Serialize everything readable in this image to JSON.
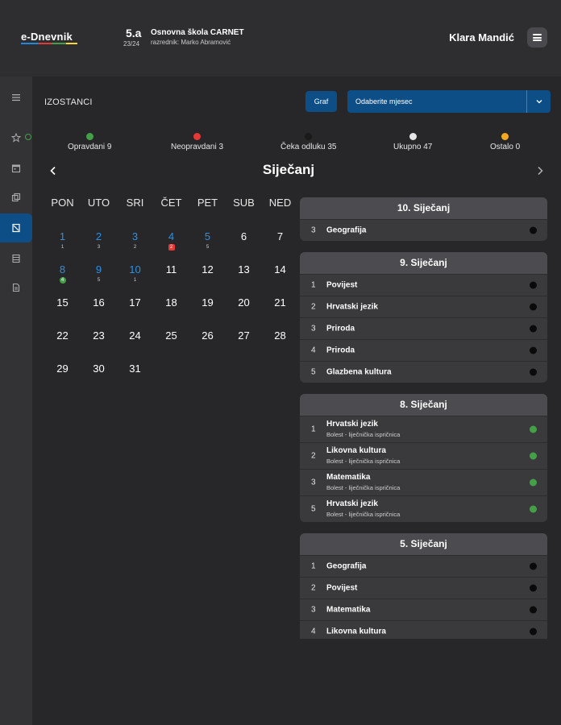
{
  "header": {
    "logo": "e-Dnevnik",
    "class_name": "5.a",
    "class_year": "23/24",
    "school_name": "Osnovna škola CARNET",
    "teacher": "razrednik: Marko Abramović",
    "user_name": "Klara Mandić"
  },
  "sidebar": {
    "items": [
      {
        "icon": "menu-icon"
      },
      {
        "icon": "star-icon"
      },
      {
        "icon": "calendar-icon"
      },
      {
        "icon": "copy-icon"
      },
      {
        "icon": "absence-icon",
        "active": true
      },
      {
        "icon": "list-icon"
      },
      {
        "icon": "document-icon"
      }
    ]
  },
  "toolbar": {
    "title": "IZOSTANCI",
    "graf_label": "Graf",
    "month_placeholder": "Odaberite mjesec"
  },
  "stats": {
    "opravdani": "Opravdani 9",
    "neopravdani": "Neopravdani 3",
    "ceka": "Čeka odluku 35",
    "ukupno": "Ukupno 47",
    "ostalo": "Ostalo 0"
  },
  "colors": {
    "opravdani": "#43a047",
    "neopravdani": "#e53935",
    "ceka": "#1a1a1a",
    "ukupno": "#e6e6e6",
    "ostalo": "#f5a623",
    "accent": "#0e4e86"
  },
  "calendar": {
    "month": "Siječanj",
    "weekdays": [
      "PON",
      "UTO",
      "SRI",
      "ČET",
      "PET",
      "SUB",
      "NED"
    ],
    "days": [
      {
        "d": "1",
        "blue": true,
        "badge": "1"
      },
      {
        "d": "2",
        "blue": true,
        "badge": "3"
      },
      {
        "d": "3",
        "blue": true,
        "badge": "2"
      },
      {
        "d": "4",
        "blue": true,
        "badge": "2",
        "badge_type": "red"
      },
      {
        "d": "5",
        "blue": true,
        "badge": "5"
      },
      {
        "d": "6"
      },
      {
        "d": "7"
      },
      {
        "d": "8",
        "blue": true,
        "badge": "4",
        "badge_type": "green"
      },
      {
        "d": "9",
        "blue": true,
        "badge": "5"
      },
      {
        "d": "10",
        "blue": true,
        "badge": "1"
      },
      {
        "d": "11"
      },
      {
        "d": "12"
      },
      {
        "d": "13"
      },
      {
        "d": "14"
      },
      {
        "d": "15"
      },
      {
        "d": "16"
      },
      {
        "d": "17"
      },
      {
        "d": "18"
      },
      {
        "d": "19"
      },
      {
        "d": "20"
      },
      {
        "d": "21"
      },
      {
        "d": "22"
      },
      {
        "d": "23"
      },
      {
        "d": "24"
      },
      {
        "d": "25"
      },
      {
        "d": "26"
      },
      {
        "d": "27"
      },
      {
        "d": "28"
      },
      {
        "d": "29"
      },
      {
        "d": "30"
      },
      {
        "d": "31"
      }
    ]
  },
  "day_cards": [
    {
      "title": "10. Siječanj",
      "rows": [
        {
          "num": "3",
          "subject": "Geografija",
          "status": "black"
        }
      ]
    },
    {
      "title": "9. Siječanj",
      "rows": [
        {
          "num": "1",
          "subject": "Povijest",
          "status": "black"
        },
        {
          "num": "2",
          "subject": "Hrvatski jezik",
          "status": "black"
        },
        {
          "num": "3",
          "subject": "Priroda",
          "status": "black"
        },
        {
          "num": "4",
          "subject": "Priroda",
          "status": "black"
        },
        {
          "num": "5",
          "subject": "Glazbena kultura",
          "status": "black"
        }
      ]
    },
    {
      "title": "8. Siječanj",
      "rows": [
        {
          "num": "1",
          "subject": "Hrvatski jezik",
          "note": "Bolest - liječnička ispričnica",
          "status": "green"
        },
        {
          "num": "2",
          "subject": "Likovna kultura",
          "note": "Bolest - liječnička ispričnica",
          "status": "green"
        },
        {
          "num": "3",
          "subject": "Matematika",
          "note": "Bolest - liječnička ispričnica",
          "status": "green"
        },
        {
          "num": "5",
          "subject": "Hrvatski jezik",
          "note": "Bolest - liječnička ispričnica",
          "status": "green"
        }
      ]
    },
    {
      "title": "5. Siječanj",
      "rows": [
        {
          "num": "1",
          "subject": "Geografija",
          "status": "black"
        },
        {
          "num": "2",
          "subject": "Povijest",
          "status": "black"
        },
        {
          "num": "3",
          "subject": "Matematika",
          "status": "black"
        },
        {
          "num": "4",
          "subject": "Likovna kultura",
          "status": "black"
        }
      ]
    }
  ]
}
